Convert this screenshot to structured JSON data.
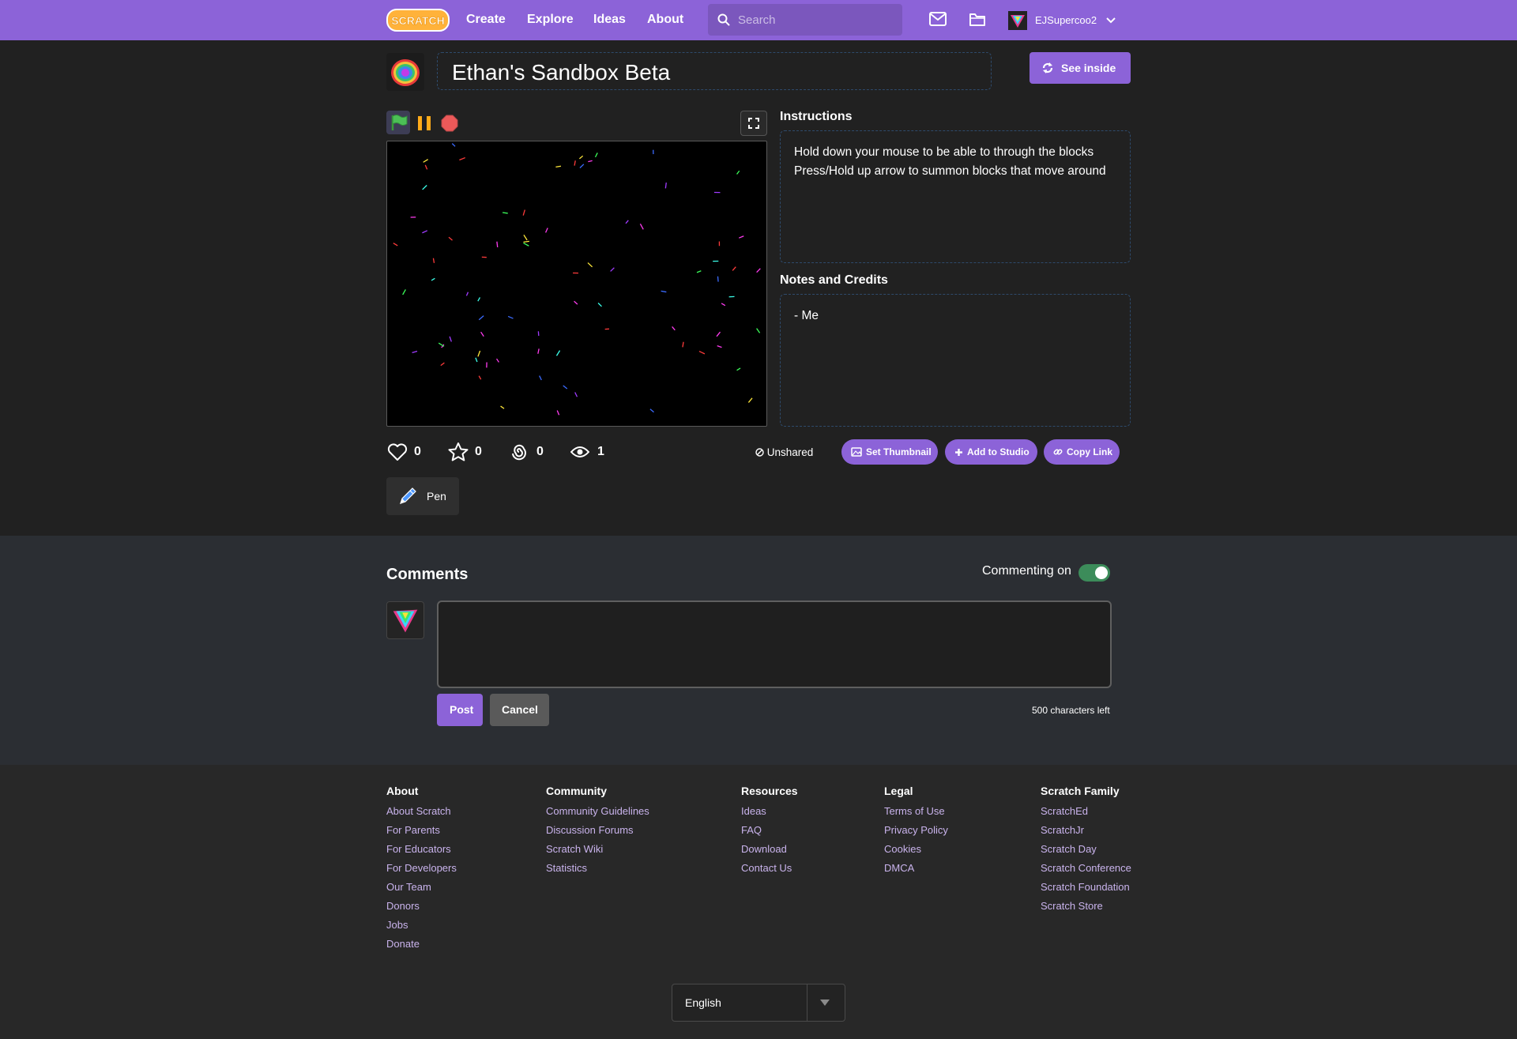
{
  "nav": {
    "logo_text": "SCRATCH",
    "links": [
      "Create",
      "Explore",
      "Ideas",
      "About"
    ],
    "search_placeholder": "Search",
    "username": "EJSupercoo2"
  },
  "project": {
    "title": "Ethan's Sandbox Beta",
    "see_inside_label": "See inside",
    "instructions_heading": "Instructions",
    "instructions_lines": [
      "Hold down your mouse to be able to through the blocks",
      "Press/Hold up arrow to summon blocks that move around"
    ],
    "notes_heading": "Notes and Credits",
    "notes_text": "- Me"
  },
  "stats": {
    "loves": "0",
    "favorites": "0",
    "remixes": "0",
    "views": "1",
    "share_status": "Unshared",
    "actions": [
      "Set Thumbnail",
      "Add to Studio",
      "Copy Link"
    ],
    "extension_label": "Pen"
  },
  "comments": {
    "heading": "Comments",
    "commenting_label": "Commenting on",
    "commenting_enabled": true,
    "post_label": "Post",
    "cancel_label": "Cancel",
    "chars_left": "500 characters left"
  },
  "footer": {
    "columns": [
      {
        "heading": "About",
        "links": [
          "About Scratch",
          "For Parents",
          "For Educators",
          "For Developers",
          "Our Team",
          "Donors",
          "Jobs",
          "Donate"
        ]
      },
      {
        "heading": "Community",
        "links": [
          "Community Guidelines",
          "Discussion Forums",
          "Scratch Wiki",
          "Statistics"
        ]
      },
      {
        "heading": "Resources",
        "links": [
          "Ideas",
          "FAQ",
          "Download",
          "Contact Us"
        ]
      },
      {
        "heading": "Legal",
        "links": [
          "Terms of Use",
          "Privacy Policy",
          "Cookies",
          "DMCA"
        ]
      },
      {
        "heading": "Scratch Family",
        "links": [
          "ScratchEd",
          "ScratchJr",
          "Scratch Day",
          "Scratch Conference",
          "Scratch Foundation",
          "Scratch Store"
        ]
      }
    ],
    "language": "English"
  },
  "colors": {
    "brand_purple": "#8c63d8",
    "page_bg": "#212121",
    "comments_bg": "#2b2e33",
    "footer_bg": "#282828",
    "footer_link": "#c9b3ec"
  }
}
